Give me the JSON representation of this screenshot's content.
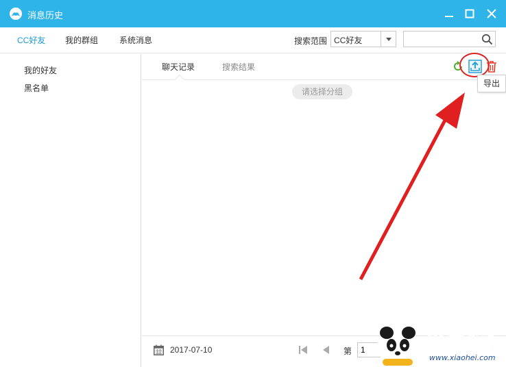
{
  "window": {
    "title": "消息历史"
  },
  "nav": {
    "tabs": [
      {
        "label": "CC好友",
        "active": true
      },
      {
        "label": "我的群组",
        "active": false
      },
      {
        "label": "系统消息",
        "active": false
      }
    ],
    "scope_label": "搜索范围",
    "scope_value": "CC好友",
    "search_value": ""
  },
  "sidebar": {
    "items": [
      {
        "label": "我的好友"
      },
      {
        "label": "黑名单"
      }
    ]
  },
  "main": {
    "tabs": [
      {
        "label": "聊天记录",
        "active": true
      },
      {
        "label": "搜索结果",
        "active": false
      }
    ],
    "group_placeholder": "请选择分组",
    "tooltip": "导出",
    "toolbar_icons": [
      "refresh-icon",
      "export-icon",
      "delete-icon"
    ]
  },
  "footer": {
    "date": "2017-07-10",
    "page_label": "第",
    "page_value": "1"
  },
  "watermark": {
    "text": "小黑游戏",
    "url": "www.xiaohei.com"
  },
  "colors": {
    "titlebar": "#2eb4e8",
    "accent": "#1a9ad6",
    "annotation": "#e02020"
  }
}
